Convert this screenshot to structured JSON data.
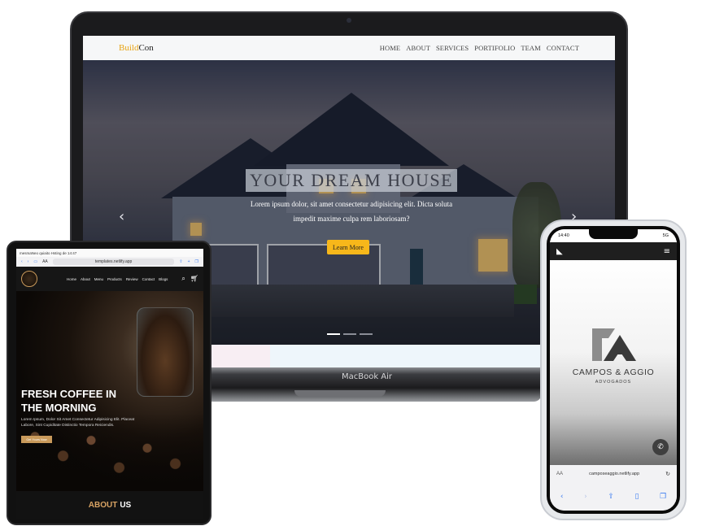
{
  "laptop": {
    "logo_part1": "Build",
    "logo_part2": "Con",
    "menu": [
      "HOME",
      "ABOUT",
      "SERVICES",
      "PORTIFOLIO",
      "TEAM",
      "CONTACT"
    ],
    "hero_title": "YOUR DREAM HOUSE",
    "hero_subtitle": "Lorem ipsum dolor, sit amet consectetur adipisicing elit. Dicta soluta impedit maxime culpa rem laboriosam?",
    "cta_label": "Learn More",
    "prev_glyph": "‹",
    "next_glyph": "›",
    "model_label": "MacBook Air",
    "accent_color": "#f7b71a"
  },
  "tablet": {
    "status_text": "mesmaNeo quiaito Hsting de 14:47",
    "url": "templates.netlify.app",
    "url_prefix": "AA",
    "menu": [
      "Home",
      "About",
      "Menu",
      "Products",
      "Review",
      "Contact",
      "Blogs"
    ],
    "hero_title": "FRESH COFFEE IN THE MORNING",
    "hero_text": "Lorem Ipsum, Dolor Sit Amet Consectetur Adipisicing Elit. Placeat Labore, Sint Cupiditate Distinctio Tempora Reiciendis.",
    "cta_label": "Get Yours Now",
    "about_part1": "ABOUT",
    "about_part2": "US",
    "accent_color": "#d7a263"
  },
  "phone": {
    "time": "14:40",
    "signal": "5G",
    "brand_name": "CAMPOS & AGGIO",
    "brand_sub": "ADVOGADOS",
    "url": "camposeaggio.netlify.app",
    "url_prefix": "AA"
  }
}
